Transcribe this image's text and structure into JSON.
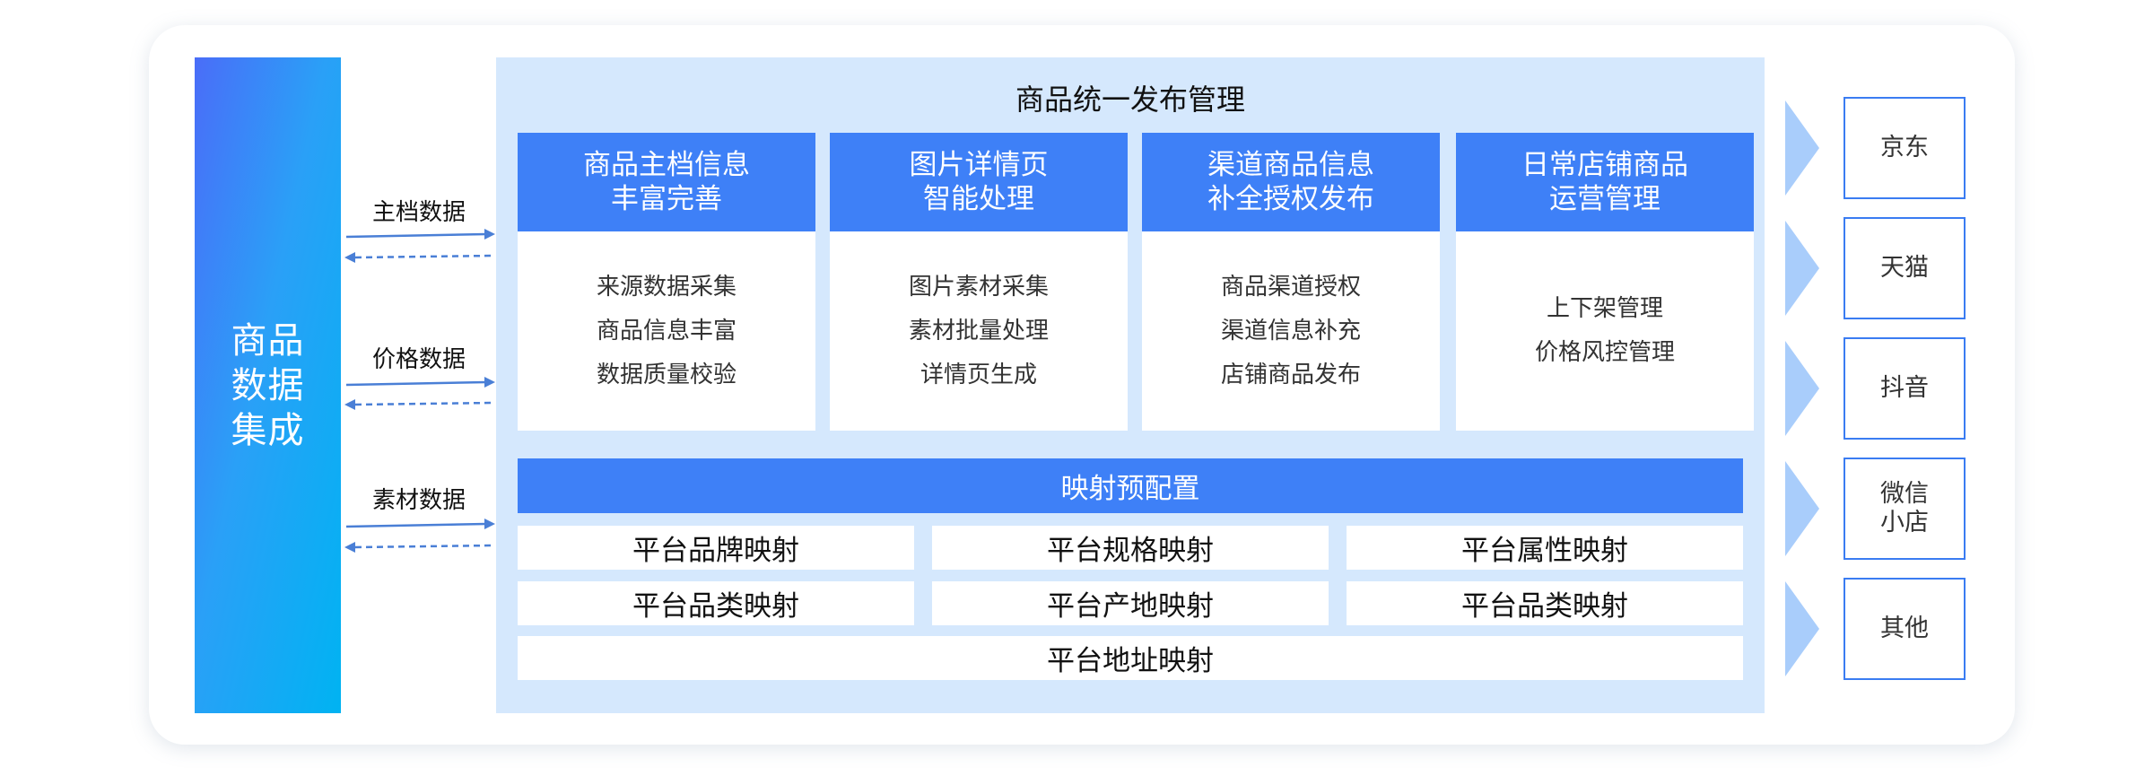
{
  "source": {
    "title": "商品数据集成"
  },
  "flows": [
    {
      "label": "主档数据"
    },
    {
      "label": "价格数据"
    },
    {
      "label": "素材数据"
    }
  ],
  "main": {
    "title": "商品统一发布管理",
    "modules": [
      {
        "title_lines": [
          "商品主档信息",
          "丰富完善"
        ],
        "items": [
          "来源数据采集",
          "商品信息丰富",
          "数据质量校验"
        ]
      },
      {
        "title_lines": [
          "图片详情页",
          "智能处理"
        ],
        "items": [
          "图片素材采集",
          "素材批量处理",
          "详情页生成"
        ]
      },
      {
        "title_lines": [
          "渠道商品信息",
          "补全授权发布"
        ],
        "items": [
          "商品渠道授权",
          "渠道信息补充",
          "店铺商品发布"
        ]
      },
      {
        "title_lines": [
          "日常店铺商品",
          "运营管理"
        ],
        "items": [
          "上下架管理",
          "价格风控管理"
        ]
      }
    ],
    "mapping": {
      "title": "映射预配置",
      "rows": [
        [
          "平台品牌映射",
          "平台规格映射",
          "平台属性映射"
        ],
        [
          "平台品类映射",
          "平台产地映射",
          "平台品类映射"
        ],
        [
          "平台地址映射"
        ]
      ]
    }
  },
  "channels": [
    {
      "label": "京东"
    },
    {
      "label": "天猫"
    },
    {
      "label": "抖音"
    },
    {
      "label": "微信小店"
    },
    {
      "label": "其他"
    }
  ],
  "colors": {
    "accent": "#3e80f7",
    "panel": "#d5e8fd",
    "arrow": "#4a7fd6",
    "chevron": "#a9cdfb"
  }
}
